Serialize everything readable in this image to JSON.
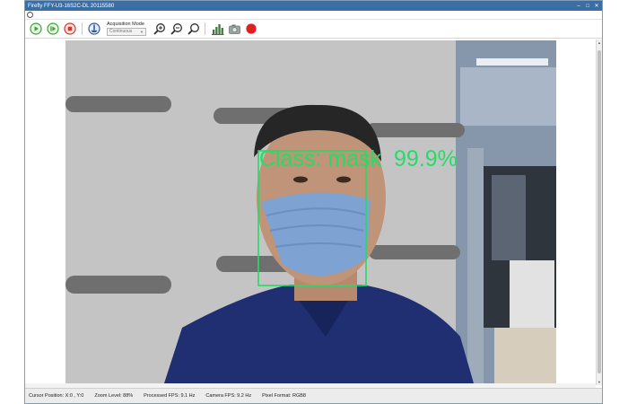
{
  "window": {
    "title": "Firefly FFY-U3-16S2C-DL 20115580",
    "controls": {
      "minimize": "–",
      "maximize": "□",
      "close": "✕"
    }
  },
  "toolbar": {
    "acquisition_label": "Acquisition Mode",
    "acquisition_value": "Continuous",
    "icons": [
      "play-icon",
      "play-single-icon",
      "stop-icon",
      "camera-settings-icon",
      "zoom-in-icon",
      "zoom-out-icon",
      "zoom-fit-icon",
      "histogram-icon",
      "camera-icon",
      "record-icon"
    ]
  },
  "overlay": {
    "detection_label": "Class: mask  99.9%",
    "box_color": "#22dd66"
  },
  "status": {
    "cursor": "Cursor Position: X:0 , Y:0",
    "zoom": "Zoom Level: 88%",
    "processed_fps": "Processed FPS: 9.1 Hz",
    "camera_fps": "Camera FPS: 9.2 Hz",
    "pixel_format": "Pixel Format: RGB8"
  },
  "colors": {
    "titlebar": "#3b6ea5",
    "play": "#3aa335",
    "stop": "#d9342b",
    "record": "#e02020"
  }
}
